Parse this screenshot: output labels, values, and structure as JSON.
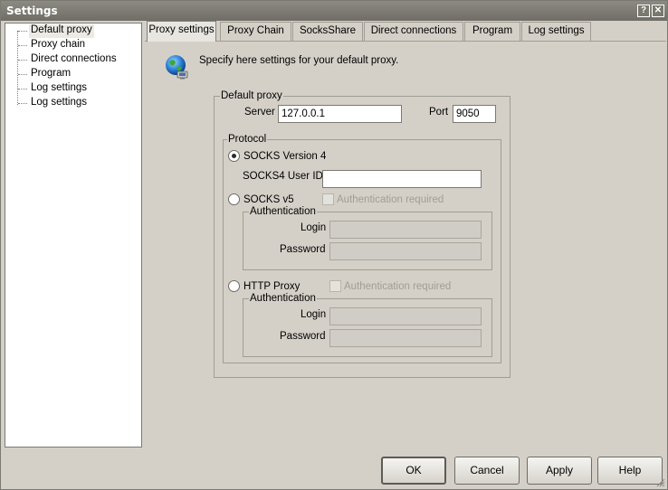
{
  "window": {
    "title": "Settings",
    "help_btn": "?",
    "close_btn": "✕"
  },
  "sidebar": {
    "items": [
      {
        "label": "Default proxy",
        "selected": true
      },
      {
        "label": "Proxy chain"
      },
      {
        "label": "Direct connections"
      },
      {
        "label": "Program"
      },
      {
        "label": "Log settings"
      },
      {
        "label": "Log settings"
      }
    ]
  },
  "tabs": [
    {
      "label": "Proxy settings",
      "active": true
    },
    {
      "label": "Proxy Chain"
    },
    {
      "label": "SocksShare"
    },
    {
      "label": "Direct connections"
    },
    {
      "label": "Program"
    },
    {
      "label": "Log settings"
    }
  ],
  "intro": {
    "text": "Specify here settings for your default proxy.",
    "icon": "globe-network-icon"
  },
  "default_proxy": {
    "legend": "Default proxy",
    "server_label": "Server",
    "server_value": "127.0.0.1",
    "port_label": "Port",
    "port_value": "9050"
  },
  "protocol": {
    "legend": "Protocol",
    "socks4": {
      "label": "SOCKS Version 4",
      "selected": true,
      "userid_label": "SOCKS4 User ID",
      "userid_value": ""
    },
    "socks5": {
      "label": "SOCKS v5",
      "selected": false,
      "auth_required_label": "Authentication required",
      "auth_legend": "Authentication",
      "login_label": "Login",
      "password_label": "Password"
    },
    "http": {
      "label": "HTTP Proxy",
      "selected": false,
      "auth_required_label": "Authentication required",
      "auth_legend": "Authentication",
      "login_label": "Login",
      "password_label": "Password"
    }
  },
  "buttons": {
    "ok": "OK",
    "cancel": "Cancel",
    "apply": "Apply",
    "help": "Help"
  }
}
